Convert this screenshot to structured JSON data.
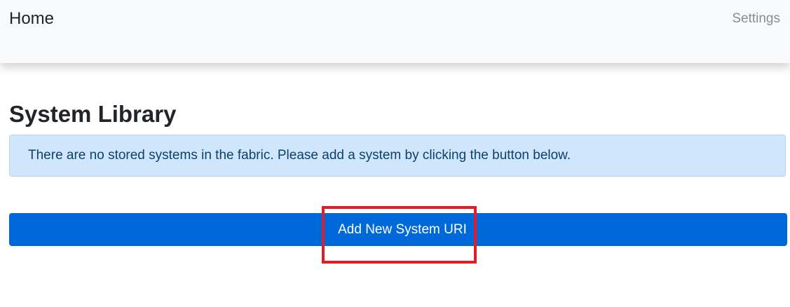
{
  "navbar": {
    "brand": "Home",
    "settings_link": "Settings"
  },
  "main": {
    "title": "System Library",
    "alert_message": "There are no stored systems in the fabric. Please add a system by clicking the button below.",
    "add_button_label": "Add New System URI"
  },
  "colors": {
    "primary_button": "#0069d9",
    "alert_background": "#cfe6fc",
    "alert_text": "#0d3f70",
    "highlight": "#e01e2b",
    "navbar_background": "#f8f9fa"
  }
}
